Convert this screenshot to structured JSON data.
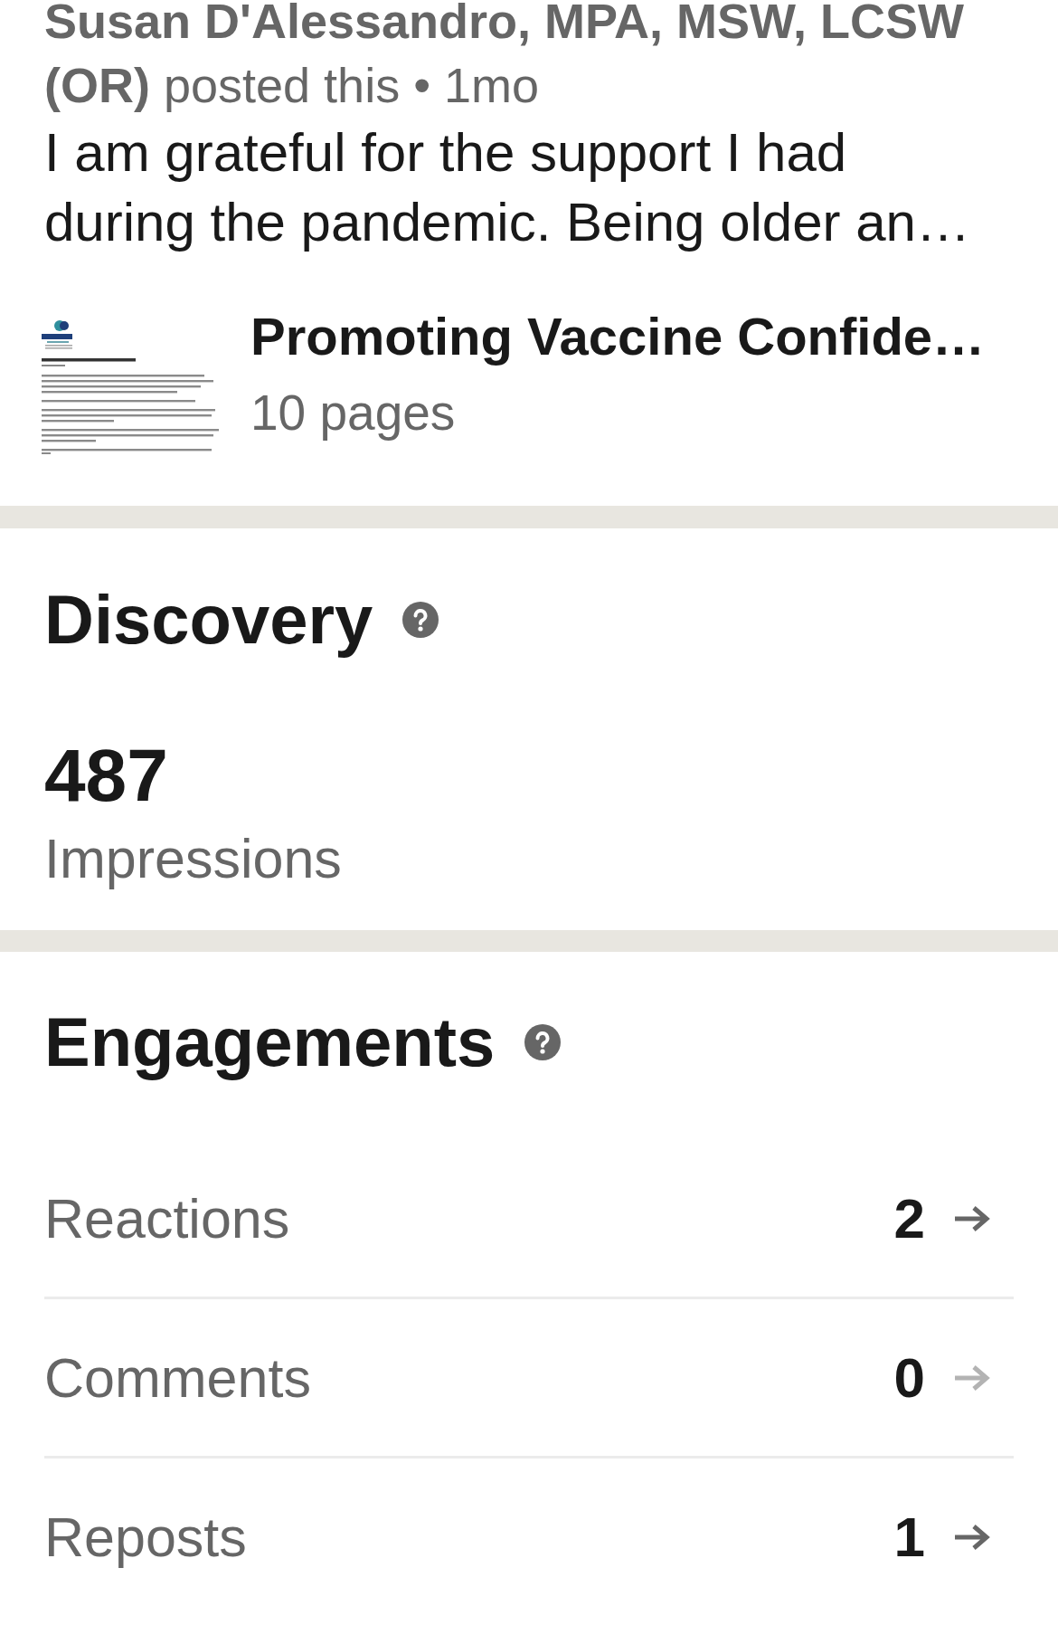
{
  "post": {
    "byline": "**Susan D'Alessandro, MPA, MSW, LCSW (OR)** posted this • 1mo",
    "text": "I am grateful for the support I had during the pandemic. Being older an…"
  },
  "document": {
    "title": "Promoting Vaccine Confide…",
    "pages": "10 pages"
  },
  "discovery": {
    "title": "Discovery",
    "value": "487",
    "label": "Impressions"
  },
  "engagements": {
    "title": "Engagements",
    "rows": [
      {
        "label": "Reactions",
        "value": "2",
        "disabled": false
      },
      {
        "label": "Comments",
        "value": "0",
        "disabled": true
      },
      {
        "label": "Reposts",
        "value": "1",
        "disabled": false
      }
    ]
  }
}
